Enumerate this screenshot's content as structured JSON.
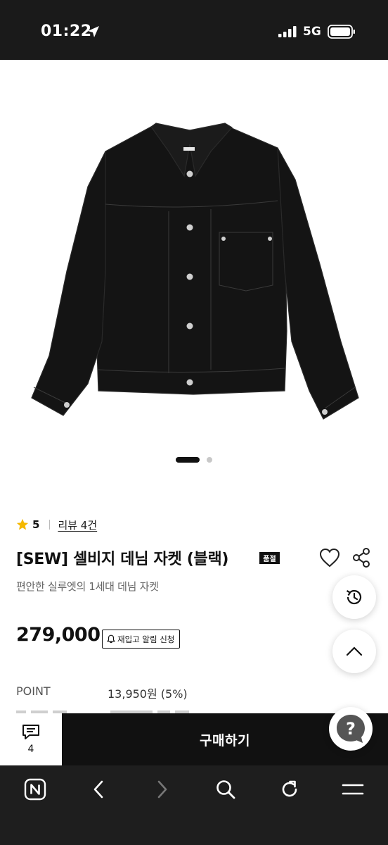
{
  "status_bar": {
    "time": "01:22",
    "network": "5G"
  },
  "product": {
    "rating": "5",
    "review_link": "리뷰 4건",
    "title": "[SEW] 셀비지 데님 자켓 (블랙)",
    "soldout_badge": "품절",
    "subtitle": "편안한 실루엣의 1세대 데님 자켓",
    "price": "279,000",
    "restock_label": "재입고 알림 신청",
    "point_label": "POINT",
    "point_value": "13,950원 (5%)"
  },
  "carousel": {
    "active_index": 1,
    "total": 2
  },
  "buy_bar": {
    "review_count": "4",
    "buy_label": "구매하기"
  },
  "colors": {
    "status_bar_bg": "#1a1a1a",
    "buy_bar_bg": "#111111",
    "browser_bar_bg": "#1e1e1e",
    "star": "#f5b800",
    "help_fab": "#555555"
  },
  "icons": {
    "status": [
      "location-arrow-icon",
      "signal-icon",
      "battery-icon"
    ],
    "product_actions": [
      "heart-icon",
      "share-icon"
    ],
    "floating": [
      "history-icon",
      "chevron-up-icon",
      "help-icon"
    ],
    "browser_toolbar": [
      "naver-icon",
      "back-icon",
      "forward-icon",
      "search-icon",
      "refresh-icon",
      "menu-icon"
    ]
  }
}
